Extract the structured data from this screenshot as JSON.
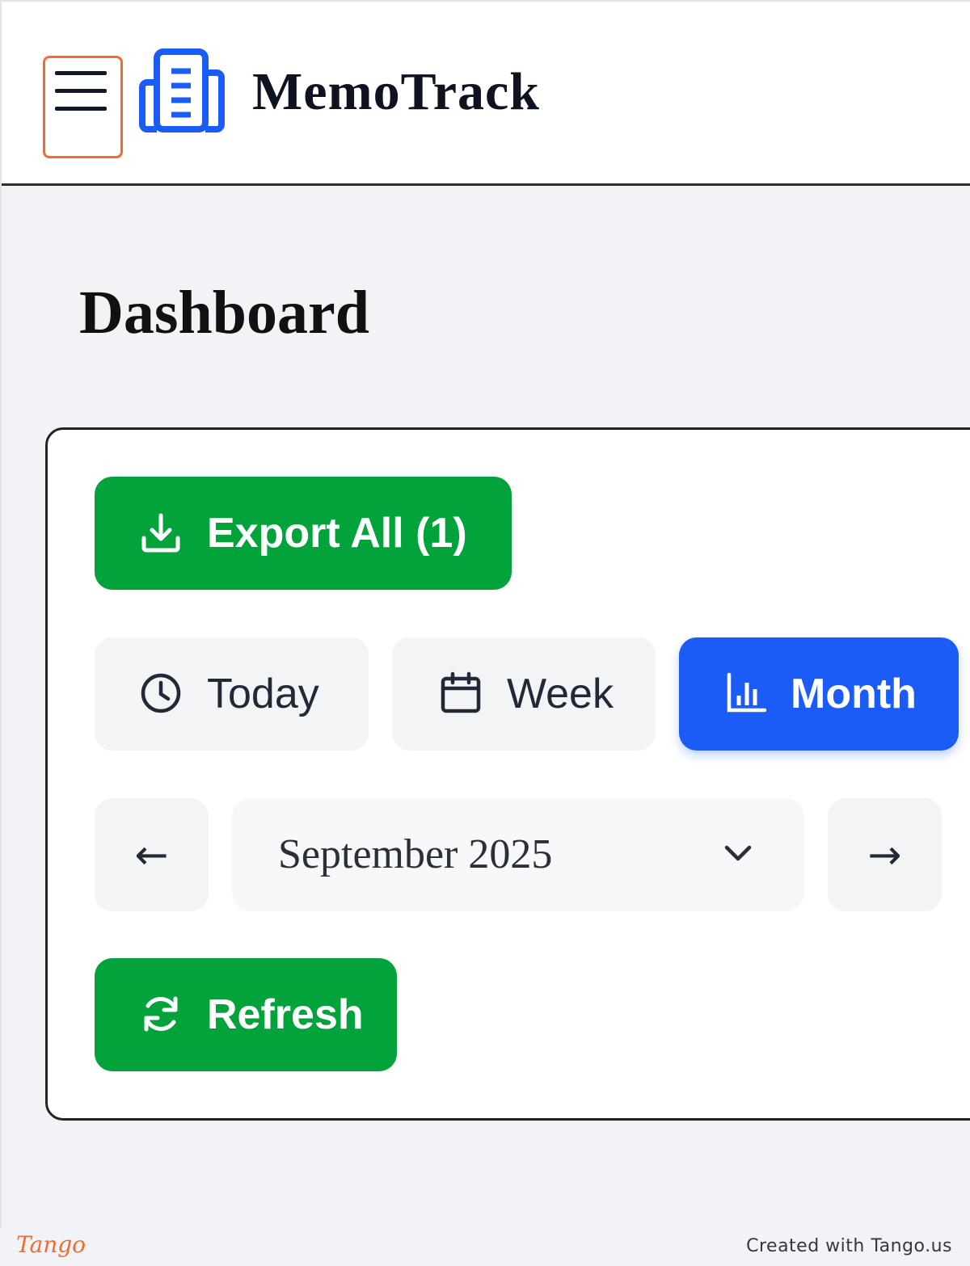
{
  "header": {
    "app_name": "MemoTrack",
    "menu_icon": "hamburger-icon",
    "logo_icon": "document-stack-icon"
  },
  "main": {
    "page_title": "Dashboard",
    "export_button": {
      "label": "Export All (1)",
      "icon": "download-icon"
    },
    "range_tabs": [
      {
        "label": "Today",
        "icon": "clock-icon",
        "selected": false
      },
      {
        "label": "Week",
        "icon": "calendar-icon",
        "selected": false
      },
      {
        "label": "Month",
        "icon": "bar-chart-icon",
        "selected": true
      }
    ],
    "period_nav": {
      "prev_label": "←",
      "next_label": "→",
      "selected_period": "September 2025",
      "dropdown_icon": "chevron-down-icon"
    },
    "refresh_button": {
      "label": "Refresh",
      "icon": "refresh-icon"
    }
  },
  "footer": {
    "brand": "Tango",
    "credit": "Created with Tango.us"
  },
  "colors": {
    "primary_green": "#03a33b",
    "accent_blue": "#1a5cf5",
    "highlight_orange": "#f26b32",
    "background": "#f2f3f6"
  }
}
